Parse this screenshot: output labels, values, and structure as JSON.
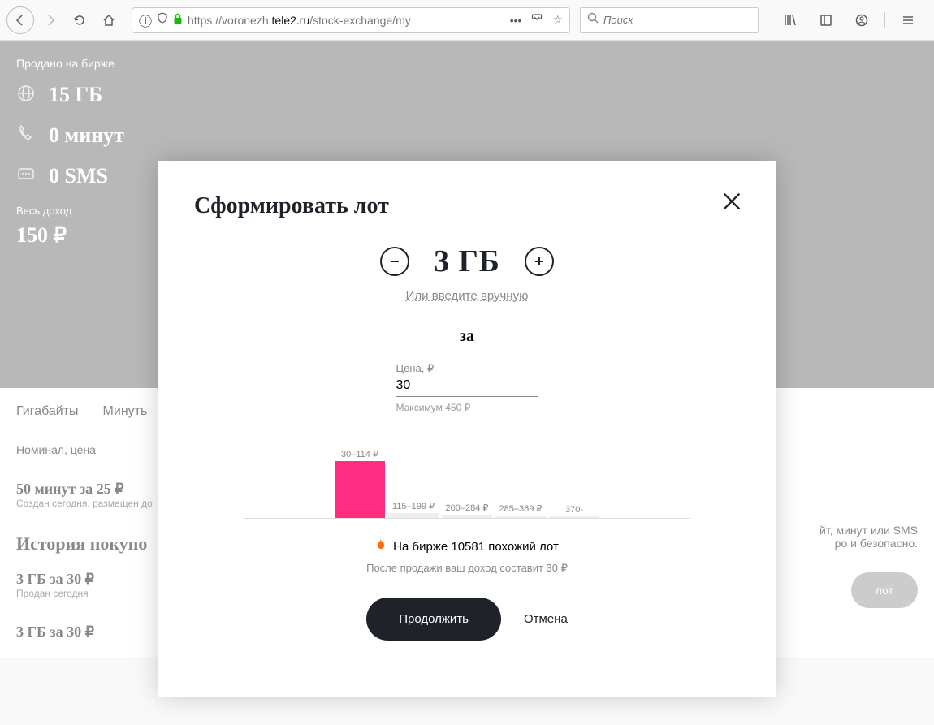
{
  "browser": {
    "url_prefix": "https://voronezh.",
    "url_domain": "tele2.ru",
    "url_suffix": "/stock-exchange/my",
    "search_placeholder": "Поиск"
  },
  "background": {
    "sold_title": "Продано на бирже",
    "stats": {
      "gb": "15 ГБ",
      "min": "0 минут",
      "sms": "0 SMS"
    },
    "income_label": "Весь доход",
    "income_value": "150 ₽",
    "tabs": {
      "gb": "Гигабайты",
      "min": "Минуть"
    },
    "nominal": "Номинал, цена",
    "listing_title": "50 минут за 25 ₽",
    "listing_sub": "Создан сегодня, размещен до",
    "history_title": "История покупо",
    "h1_title": "3 ГБ за 30 ₽",
    "h1_sub": "Продан сегодня",
    "h2_title": "3 ГБ за 30 ₽",
    "promo_line1": "йт, минут или SMS",
    "promo_line2": "ро и безопасно.",
    "add_lot": "лот"
  },
  "modal": {
    "title": "Сформировать лот",
    "amount": "3 ГБ",
    "manual": "Или введите вручную",
    "for": "за",
    "price_label": "Цена, ₽",
    "price_value": "30",
    "price_max": "Максимум 450 ₽",
    "histogram": {
      "bars": [
        {
          "label": "30–114 ₽",
          "height": 70,
          "active": true
        },
        {
          "label": "115–199 ₽",
          "height": 6,
          "active": false
        },
        {
          "label": "200–284 ₽",
          "height": 4,
          "active": false
        },
        {
          "label": "285–369 ₽",
          "height": 3,
          "active": false
        },
        {
          "label": "370-",
          "height": 2,
          "active": false
        }
      ]
    },
    "similar": "На бирже 10581 похожий лот",
    "after_sale": "После продажи ваш доход составит 30 ₽",
    "continue": "Продолжить",
    "cancel": "Отмена"
  }
}
